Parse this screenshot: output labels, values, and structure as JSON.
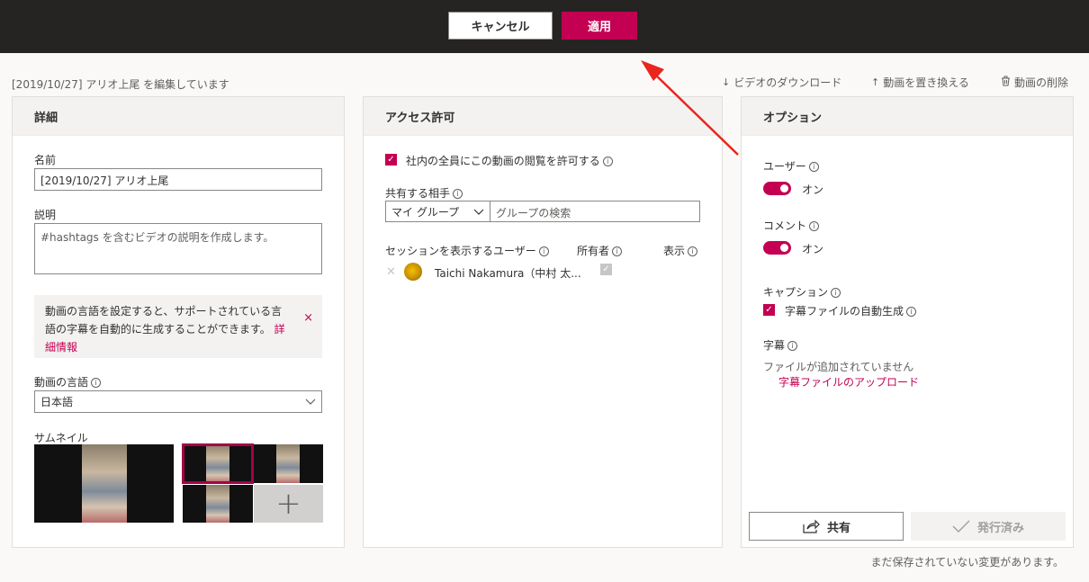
{
  "topbar": {
    "cancel": "キャンセル",
    "apply": "適用"
  },
  "header": {
    "editing": "[2019/10/27] アリオ上尾 を編集しています",
    "download": "ビデオのダウンロード",
    "replace": "動画を置き換える",
    "delete": "動画の削除"
  },
  "details": {
    "title": "詳細",
    "name_label": "名前",
    "name_value": "[2019/10/27] アリオ上尾",
    "desc_label": "説明",
    "desc_placeholder": "#hashtags を含むビデオの説明を作成します。",
    "notice_text": "動画の言語を設定すると、サポートされている言語の字幕を自動的に生成することができます。",
    "notice_link": "詳細情報",
    "notice_close": "×",
    "lang_label": "動画の言語",
    "lang_value": "日本語",
    "thumb_label": "サムネイル",
    "add_thumb": "+"
  },
  "access": {
    "title": "アクセス許可",
    "allow_all": "社内の全員にこの動画の閲覧を許可する",
    "share_label": "共有する相手",
    "group_select": "マイ グループ",
    "group_search_placeholder": "グループの検索",
    "col_user": "セッションを表示するユーザー",
    "col_owner": "所有者",
    "col_display": "表示",
    "users": [
      {
        "name": "Taichi Nakamura（中村 太..."
      }
    ]
  },
  "options": {
    "title": "オプション",
    "users_label": "ユーザー",
    "users_state": "オン",
    "comments_label": "コメント",
    "comments_state": "オン",
    "captions_label": "キャプション",
    "autogen": "字幕ファイルの自動生成",
    "subtitles_label": "字幕",
    "no_files": "ファイルが追加されていません",
    "upload_link": "字幕ファイルのアップロード",
    "share_btn": "共有",
    "published_btn": "発行済み"
  },
  "footer": {
    "unsaved": "まだ保存されていない変更があります。"
  },
  "colors": {
    "accent": "#c30052",
    "topbar": "#252423",
    "arrow": "#e8261d"
  }
}
